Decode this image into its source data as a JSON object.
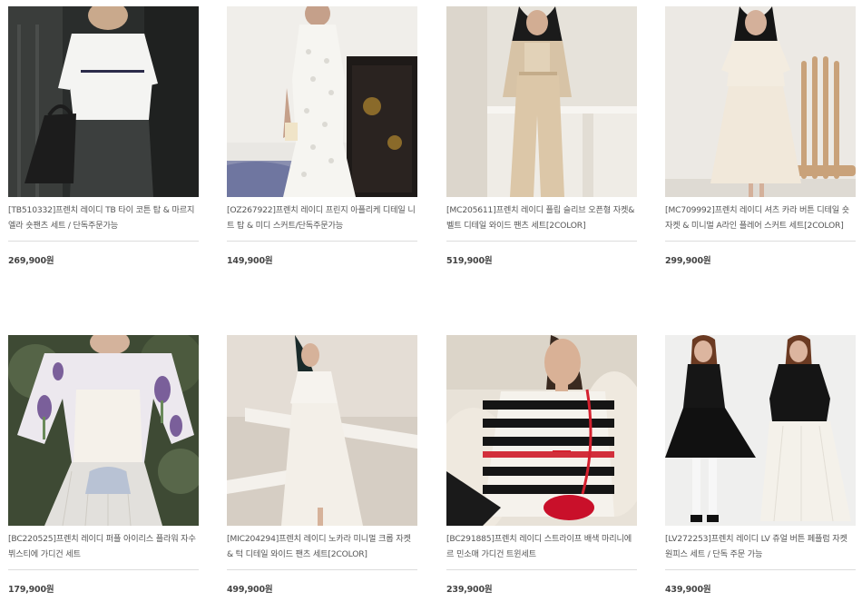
{
  "products": [
    {
      "name": "[TB510332]프렌치 레이디 TB 타이 코튼 탑 & 마르지엘라 숏팬츠 세트 / 단독주문가능",
      "price": "269,900원"
    },
    {
      "name": "[OZ267922]프렌치 레이디 프린지 아플리케 디테일 니트 탑 & 미디 스커트/단독주문가능",
      "price": "149,900원"
    },
    {
      "name": "[MC205611]프렌치 레이디 플립 슬리브 오픈형 자켓& 벨트 디테일 와이드 팬츠 세트[2COLOR]",
      "price": "519,900원"
    },
    {
      "name": "[MC709992]프렌치 레이디 셔츠 카라 버튼 디테일 숏자켓 & 미니멀 A라인 플레어 스커트 세트[2COLOR]",
      "price": "299,900원"
    },
    {
      "name": "[BC220525]프렌치 레이디 퍼플 아이리스 플라워 자수 뷔스티에 가디건 세트",
      "price": "179,900원"
    },
    {
      "name": "[MIC204294]프렌치 레이디 노카라 미니멀 크롭 자켓 & 턱 디테일 와이드 팬츠 세트[2COLOR]",
      "price": "499,900원"
    },
    {
      "name": "[BC291885]프렌치 레이디 스트라이프 배색 마리니에 르 민소매 가디건 트윈세트",
      "price": "239,900원"
    },
    {
      "name": "[LV272253]프렌치 레이디 LV 쥬얼 버튼 페플럼 자켓 원피스 세트 / 단독 주문 가능",
      "price": "439,900원"
    }
  ]
}
